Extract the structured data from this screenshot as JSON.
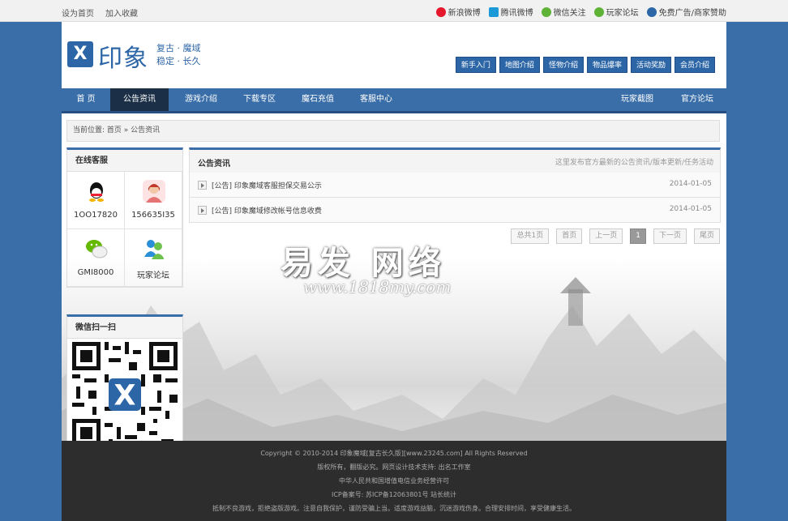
{
  "topbar": {
    "left_links": [
      "设为首页",
      "加入收藏"
    ],
    "right_links": [
      {
        "label": "新浪微博",
        "icon": "weibo-icon",
        "color": "#e6162d"
      },
      {
        "label": "腾讯微博",
        "icon": "tencent-weibo-icon",
        "color": "#1a9ad6"
      },
      {
        "label": "微信关注",
        "icon": "wechat-icon",
        "color": "#5eb236"
      },
      {
        "label": "玩家论坛",
        "icon": "forum-icon",
        "color": "#5eb236"
      },
      {
        "label": "免费广告/商家赞助",
        "icon": "sponsor-icon",
        "color": "#2d66a6"
      }
    ]
  },
  "header": {
    "logo_mark": "X",
    "logo_text": "印象",
    "slogan_line1": "复古 · 魔域",
    "slogan_line2": "稳定 · 长久",
    "quick_links": [
      "新手入门",
      "地图介绍",
      "怪物介绍",
      "物品爆率",
      "活动奖励",
      "会员介绍"
    ]
  },
  "nav": {
    "items": [
      "首 页",
      "公告资讯",
      "游戏介绍",
      "下载专区",
      "魔石充值",
      "客服中心"
    ],
    "right_items": [
      "玩家截图",
      "官方论坛"
    ],
    "active_index": 1
  },
  "breadcrumb": "当前位置: 首页 » 公告资讯",
  "sidebar": {
    "service_title": "在线客服",
    "contacts": [
      {
        "label": "1OO17820",
        "icon": "qq-icon"
      },
      {
        "label": "156635I35",
        "icon": "customer-service-icon"
      },
      {
        "label": "GMI8000",
        "icon": "wechat-icon"
      },
      {
        "label": "玩家论坛",
        "icon": "forum-icon"
      }
    ],
    "wechat_title": "微信扫一扫"
  },
  "main": {
    "title": "公告资讯",
    "description": "这里发布官方最新的公告资讯/版本更新/任务活动",
    "news": [
      {
        "title": "[公告] 印象魔域客服担保交易公示",
        "date": "2014-01-05"
      },
      {
        "title": "[公告] 印象魔域修改帐号信息收费",
        "date": "2014-01-05"
      }
    ],
    "pager": {
      "total": "总共1页",
      "first": "首页",
      "prev": "上一页",
      "current": "1",
      "next": "下一页",
      "last": "尾页"
    }
  },
  "watermark": {
    "line1": "易发  网络",
    "line2": "www.1818my.com"
  },
  "footer": {
    "lines": [
      "Copyright © 2010-2014 印象魔域[复古长久版][www.23245.com] All Rights Reserved",
      "版权所有，翻版必究。网页设计技术支持: 出名工作室",
      "中华人民共和国增值电信业务经营许可",
      "ICP备案号: 苏ICP备12063801号 站长统计",
      "抵制不良游戏，拒绝盗版游戏。注意自我保护，谨防受骗上当。适度游戏益脑，沉迷游戏伤身。合理安排时间，享受健康生活。"
    ]
  }
}
